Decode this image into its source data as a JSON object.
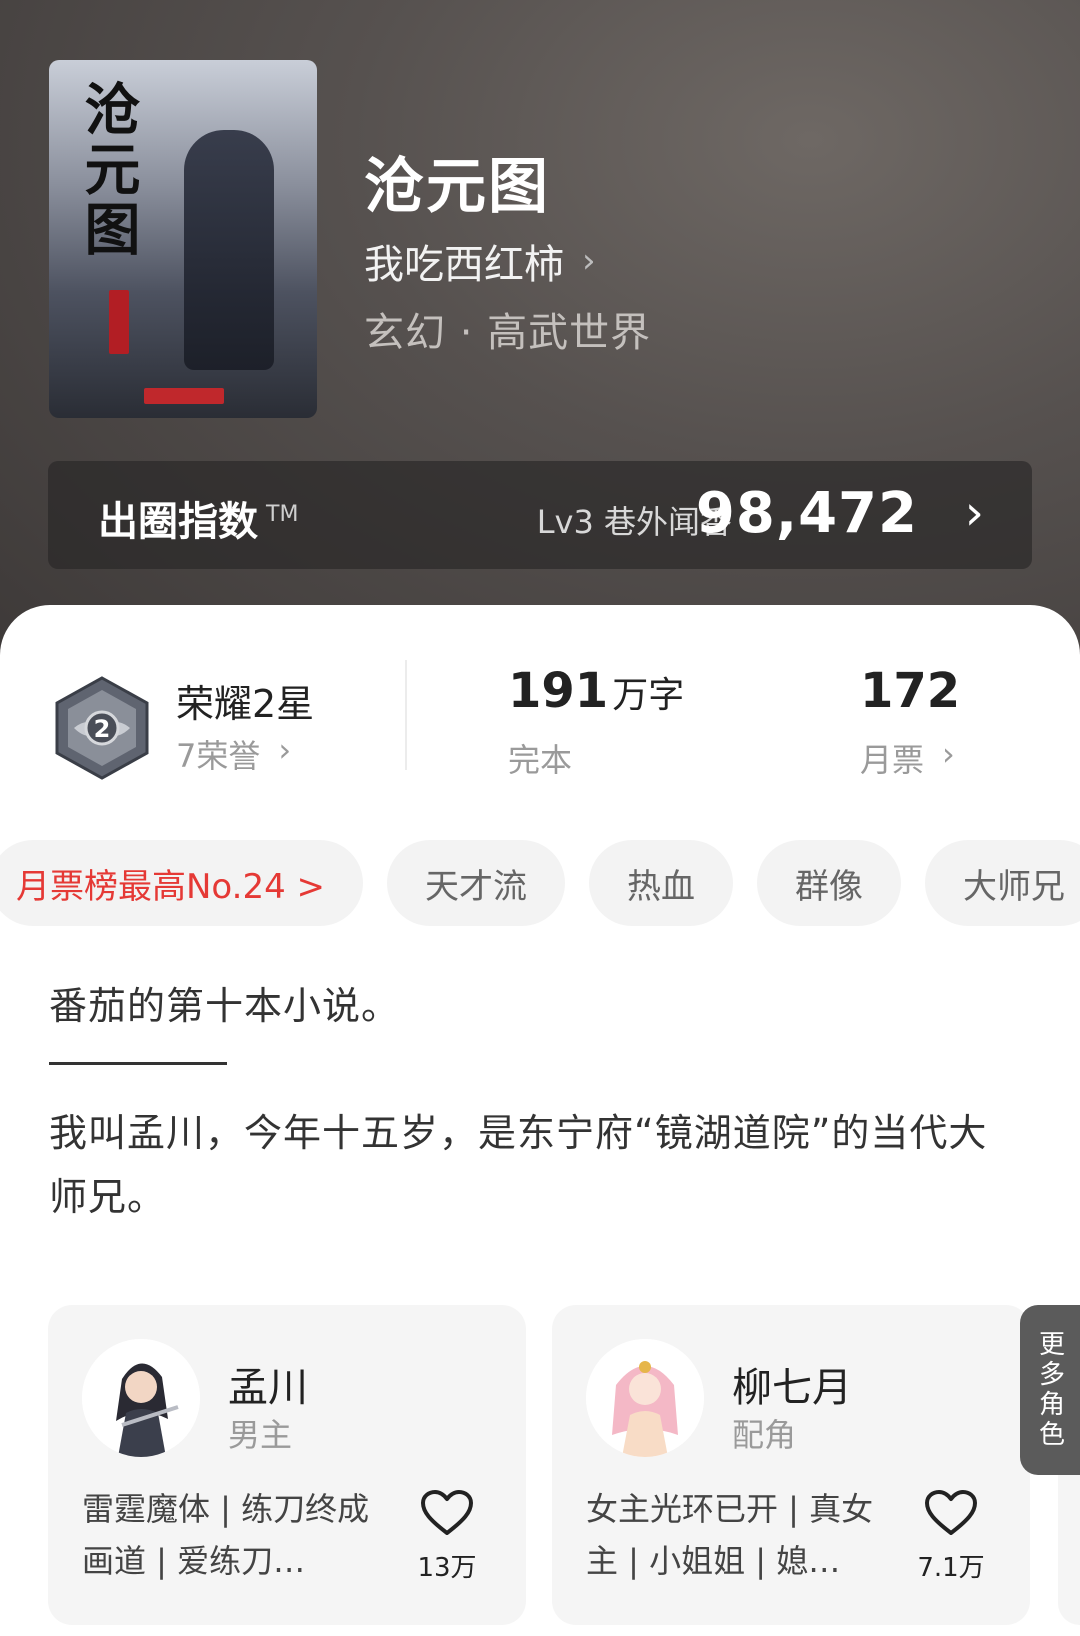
{
  "book": {
    "title": "沧元图",
    "author": "我吃西红柿",
    "author_chevron": "›",
    "genre": "玄幻 · 高武世界",
    "cover_title": "沧元图"
  },
  "index": {
    "label": "出圈指数",
    "tm": "TM",
    "level": "Lv3 巷外闻香",
    "value": "98,472",
    "chevron": "›"
  },
  "stats": {
    "honor_title": "荣耀2星",
    "honor_count": "7荣誉",
    "badge_number": "2",
    "words_num": "191",
    "words_unit": "万字",
    "status": "完本",
    "votes": "172",
    "votes_label": "月票",
    "chevron": "›"
  },
  "tags": [
    "月票榜最高No.24 >",
    "天才流",
    "热血",
    "群像",
    "大师兄"
  ],
  "intro": {
    "line1": "番茄的第十本小说。",
    "line2": "我叫孟川，今年十五岁，是东宁府“镜湖道院”的当代大师兄。"
  },
  "characters": [
    {
      "name": "孟川",
      "role": "男主",
      "desc": "雷霆魔体 | 练刀终成画道 | 爱练刀…",
      "likes": "13万"
    },
    {
      "name": "柳七月",
      "role": "配角",
      "desc": "女主光环已开 | 真女主 | 小姐姐 | 媳…",
      "likes": "7.1万"
    }
  ],
  "more_characters": "更多角色",
  "colors": {
    "accent_red": "#e53935",
    "header_dark": "#3c3837"
  }
}
